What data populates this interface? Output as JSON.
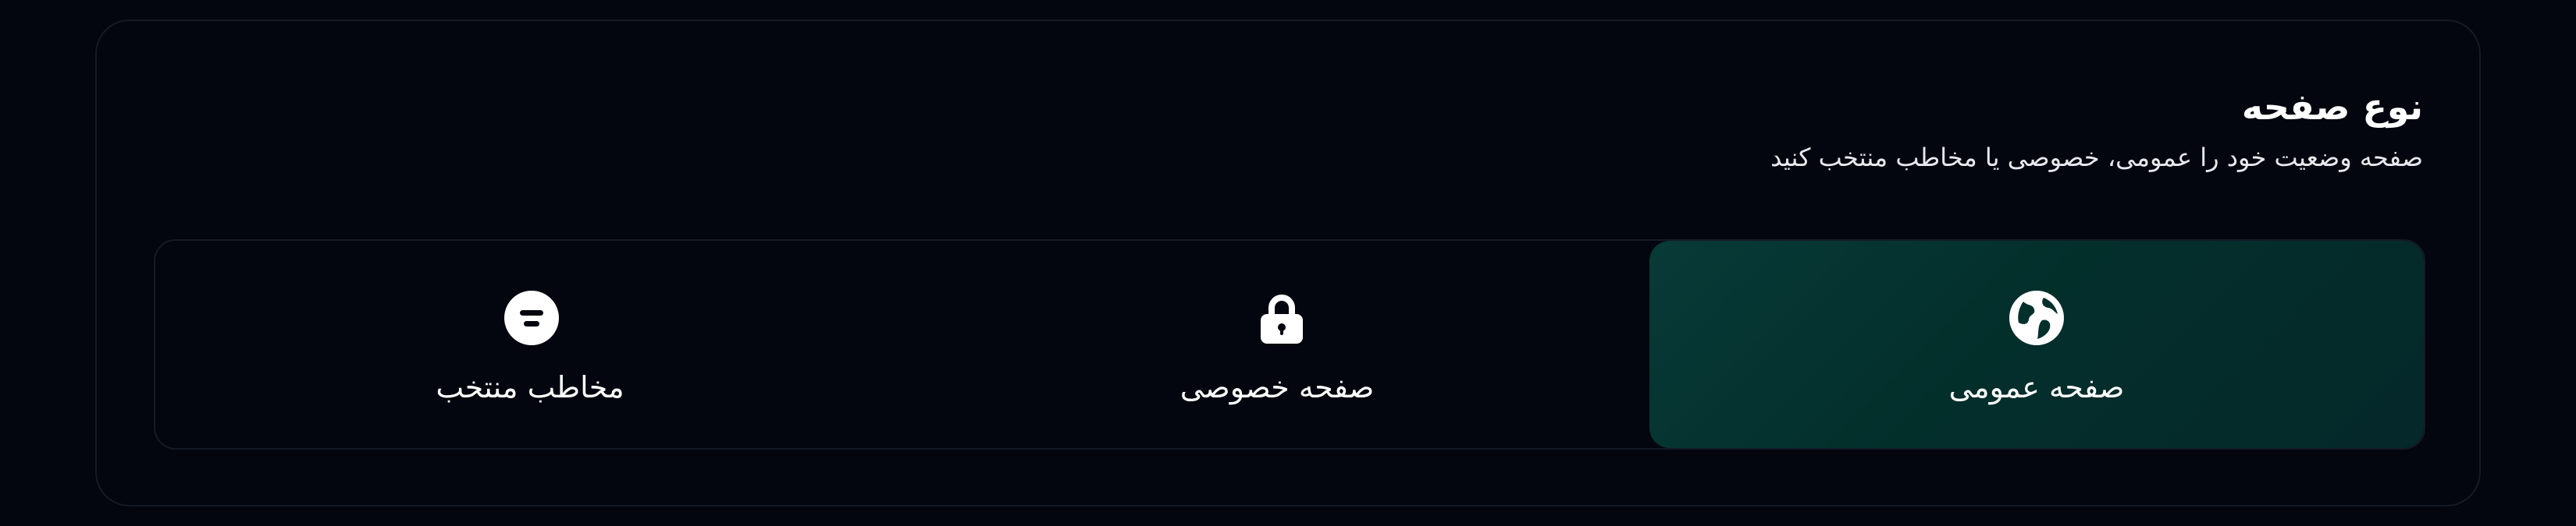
{
  "section": {
    "title": "نوع صفحه",
    "subtitle": "صفحه وضعیت خود را عمومی، خصوصی یا مخاطب منتخب کنید"
  },
  "options": [
    {
      "label": "مخاطب منتخب",
      "icon": "filter-icon",
      "selected": false
    },
    {
      "label": "صفحه خصوصی",
      "icon": "lock-icon",
      "selected": false
    },
    {
      "label": "صفحه عمومی",
      "icon": "globe-icon",
      "selected": true
    }
  ],
  "colors": {
    "background": "#03060e",
    "border": "#151a27",
    "selected_background": "#03302c",
    "text": "#ffffff"
  }
}
